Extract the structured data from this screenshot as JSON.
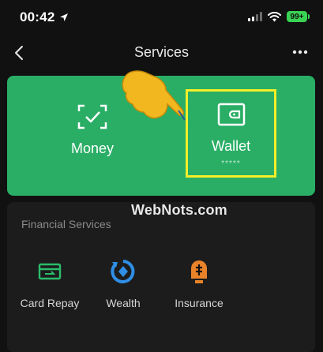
{
  "status_bar": {
    "time": "00:42",
    "battery": "99+",
    "icons": [
      "location-arrow-icon",
      "signal-icon",
      "wifi-icon",
      "battery-icon"
    ]
  },
  "nav": {
    "title": "Services",
    "back_icon": "chevron-left-icon",
    "more_icon": "more-dots-icon"
  },
  "hero": {
    "items": [
      {
        "label": "Money",
        "icon": "scan-check-icon"
      },
      {
        "label": "Wallet",
        "icon": "wallet-icon",
        "sublabel": "*****"
      }
    ]
  },
  "watermark": "WebNots.com",
  "financial_services": {
    "title": "Financial Services",
    "items": [
      {
        "label": "Card Repay",
        "icon": "card-repay-icon"
      },
      {
        "label": "Wealth",
        "icon": "wealth-icon"
      },
      {
        "label": "Insurance",
        "icon": "insurance-icon"
      }
    ]
  },
  "colors": {
    "background": "#111111",
    "hero_green": "#2aae65",
    "highlight_yellow": "#f5ee28",
    "card_repay_green": "#2bbd6b",
    "wealth_blue": "#2f8fe6",
    "insurance_orange": "#e8832a"
  }
}
